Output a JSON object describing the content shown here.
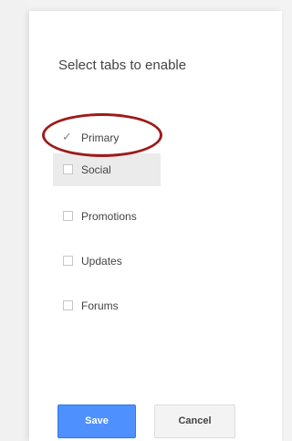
{
  "dialog": {
    "title": "Select tabs to enable"
  },
  "tabs": [
    {
      "label": "Primary",
      "checked": true,
      "icon": "check-icon"
    },
    {
      "label": "Social",
      "checked": false,
      "icon": "checkbox-icon"
    },
    {
      "label": "Promotions",
      "checked": false,
      "icon": "checkbox-icon"
    },
    {
      "label": "Updates",
      "checked": false,
      "icon": "checkbox-icon"
    },
    {
      "label": "Forums",
      "checked": false,
      "icon": "checkbox-icon"
    }
  ],
  "buttons": {
    "save_label": "Save",
    "cancel_label": "Cancel"
  },
  "colors": {
    "save_button": "#4d90fe",
    "annotation_ring": "#9e1b1b",
    "hover_row": "#ebebeb"
  }
}
